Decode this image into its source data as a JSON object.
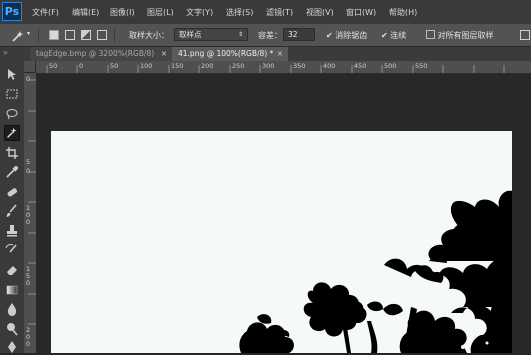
{
  "app": {
    "logo": "Ps"
  },
  "menu": [
    "文件(F)",
    "编辑(E)",
    "图像(I)",
    "图层(L)",
    "文字(Y)",
    "选择(S)",
    "滤镜(T)",
    "视图(V)",
    "窗口(W)",
    "帮助(H)"
  ],
  "options": {
    "sample_size_label": "取样大小：",
    "sample_size_value": "取样点",
    "tolerance_label": "容差：",
    "tolerance_value": "32",
    "antialias_label": "消除锯齿",
    "contiguous_label": "连续",
    "all_layers_label": "对所有图层取样"
  },
  "tabs": [
    {
      "label": "tagEdge.bmp @ 3200%(RGB/8)",
      "close": "×",
      "active": false
    },
    {
      "label": "41.png @ 100%(RGB/8) *",
      "close": "×",
      "active": true
    }
  ],
  "ruler": {
    "top": [
      "50",
      "0",
      "50",
      "100",
      "150",
      "200",
      "250",
      "300",
      "350",
      "400",
      "450",
      "500",
      "550"
    ],
    "left": [
      "0",
      "5",
      "0",
      "1 0 0",
      "1 5 0",
      "2 0 0"
    ]
  },
  "tools": [
    "move-tool",
    "marquee-tool",
    "lasso-tool",
    "magic-wand-tool",
    "crop-tool",
    "eyedropper-tool",
    "healing-brush-tool",
    "brush-tool",
    "clone-stamp-tool",
    "history-brush-tool",
    "eraser-tool",
    "gradient-tool",
    "blur-tool",
    "dodge-tool",
    "pen-tool"
  ],
  "colors": {
    "menubar": "#3a3a3a",
    "options": "#535353",
    "canvas": "#282828",
    "document": "#f5f9f9",
    "logo": "#4fb0ff"
  }
}
